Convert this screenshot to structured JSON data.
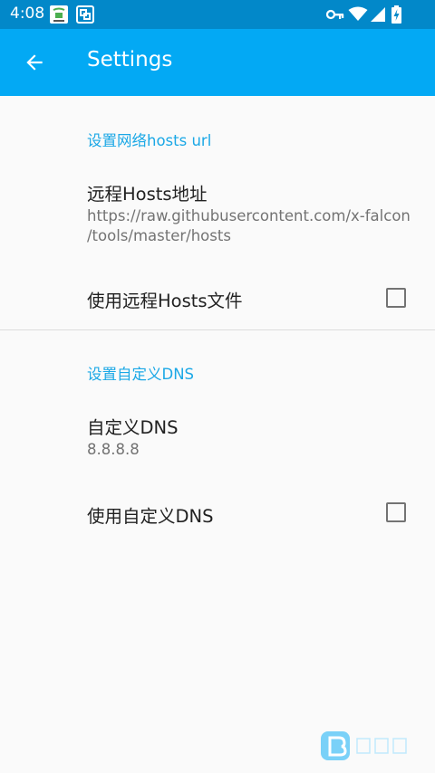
{
  "status_bar": {
    "time": "4:08",
    "icons": [
      "app-notification-icon",
      "screenshot-icon",
      "vpn-key-icon",
      "wifi-icon",
      "cell-signal-icon",
      "battery-charging-icon"
    ]
  },
  "app_bar": {
    "title": "Settings",
    "back_icon": "arrow-back-icon"
  },
  "sections": [
    {
      "category": "设置网络hosts url",
      "items": [
        {
          "title": "远程Hosts地址",
          "summary": [
            "https://raw.githubusercontent.com/x-falcon",
            "/tools/master/hosts"
          ]
        },
        {
          "title": "使用远程Hosts文件",
          "checked": false
        }
      ]
    },
    {
      "category": "设置自定义DNS",
      "items": [
        {
          "title": "自定义DNS",
          "summary": "8.8.8.8"
        },
        {
          "title": "使用自定义DNS",
          "checked": false
        }
      ]
    }
  ],
  "colors": {
    "status_bar": "#0288c9",
    "app_bar": "#03a9f4",
    "accent": "#1ba8e6",
    "background": "#fafafa"
  }
}
